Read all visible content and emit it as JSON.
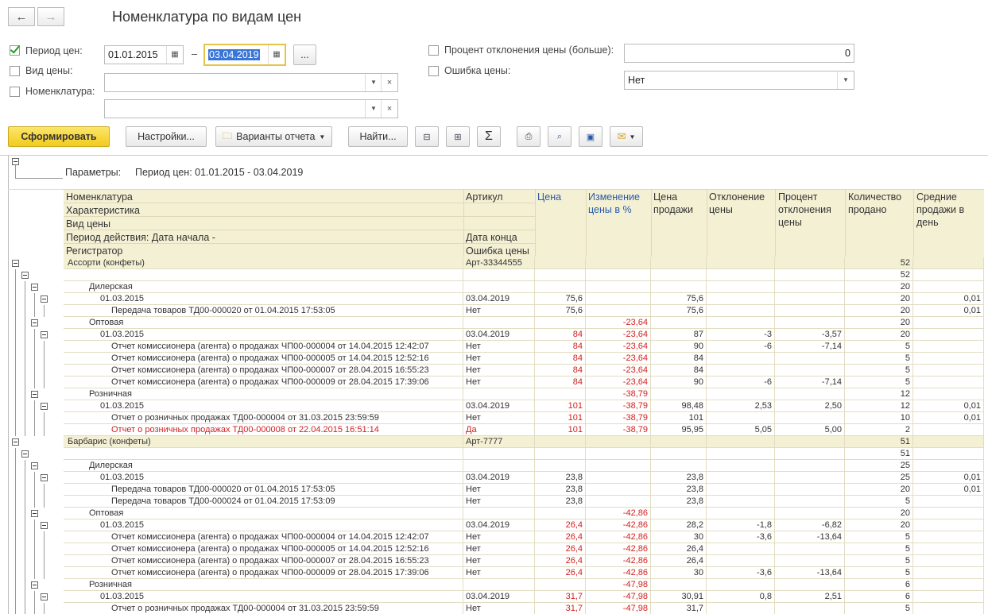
{
  "window": {
    "title": "Номенклатура по видам цен",
    "back_icon": "arrow-left-icon",
    "forward_icon": "arrow-right-icon"
  },
  "filters": {
    "period_label": "Период цен:",
    "period_checked": true,
    "date_from": "01.01.2015",
    "date_dash": "–",
    "date_to": "03.04.2019",
    "period_more": "...",
    "price_type_label": "Вид цены:",
    "nomenclature_label": "Номенклатура:",
    "deviation_label": "Процент отклонения цены (больше):",
    "deviation_value": "0",
    "price_error_label": "Ошибка цены:",
    "price_error_value": "Нет"
  },
  "toolbar": {
    "generate": "Сформировать",
    "settings": "Настройки...",
    "variants": "Варианты отчета",
    "find": "Найти..."
  },
  "report": {
    "params_label": "Параметры:",
    "params_value": "Период цен: 01.01.2015 - 03.04.2019",
    "header": {
      "nom": "Номенклатура",
      "char": "Характеристика",
      "price_type": "Вид цены",
      "period": "Период действия: Дата начала -",
      "registrar": "Регистратор",
      "article": "Артикул",
      "date_end": "Дата конца",
      "price_error": "Ошибка цены",
      "price": "Цена",
      "change": "Изменение цены в %",
      "sale_price": "Цена продажи",
      "deviation": "Отклонение цены",
      "dev_percent": "Процент отклонения цены",
      "qty": "Количество продано",
      "avg": "Средние продажи в день"
    },
    "rows": [
      {
        "lvl": 0,
        "text": "Ассорти (конфеты)",
        "art": "Арт-33344555",
        "price": "",
        "change": "",
        "sale": "",
        "dev": "",
        "pct": "",
        "qty": "52",
        "avg": "",
        "red": false,
        "group": true
      },
      {
        "lvl": 1,
        "text": "",
        "art": "",
        "price": "",
        "change": "",
        "sale": "",
        "dev": "",
        "pct": "",
        "qty": "52",
        "avg": "",
        "red": false,
        "group": false
      },
      {
        "lvl": 2,
        "text": "Дилерская",
        "art": "",
        "price": "",
        "change": "",
        "sale": "",
        "dev": "",
        "pct": "",
        "qty": "20",
        "avg": "",
        "red": false,
        "group": false
      },
      {
        "lvl": 3,
        "text": "01.03.2015",
        "art": "03.04.2019",
        "price": "75,6",
        "change": "",
        "sale": "75,6",
        "dev": "",
        "pct": "",
        "qty": "20",
        "avg": "0,01",
        "red": false,
        "group": false
      },
      {
        "lvl": 4,
        "text": "Передача товаров ТД00-000020 от 01.04.2015 17:53:05",
        "art": "Нет",
        "price": "75,6",
        "change": "",
        "sale": "75,6",
        "dev": "",
        "pct": "",
        "qty": "20",
        "avg": "0,01",
        "red": false,
        "group": false
      },
      {
        "lvl": 2,
        "text": "Оптовая",
        "art": "",
        "price": "",
        "change": "-23,64",
        "sale": "",
        "dev": "",
        "pct": "",
        "qty": "20",
        "avg": "",
        "red": false,
        "group": false
      },
      {
        "lvl": 3,
        "text": "01.03.2015",
        "art": "03.04.2019",
        "price": "84",
        "change": "-23,64",
        "sale": "87",
        "dev": "-3",
        "pct": "-3,57",
        "qty": "20",
        "avg": "",
        "red": false,
        "group": false
      },
      {
        "lvl": 4,
        "text": "Отчет комиссионера (агента) о продажах ЧП00-000004 от 14.04.2015 12:42:07",
        "art": "Нет",
        "price": "84",
        "change": "-23,64",
        "sale": "90",
        "dev": "-6",
        "pct": "-7,14",
        "qty": "5",
        "avg": "",
        "red": false,
        "group": false
      },
      {
        "lvl": 4,
        "text": "Отчет комиссионера (агента) о продажах ЧП00-000005 от 14.04.2015 12:52:16",
        "art": "Нет",
        "price": "84",
        "change": "-23,64",
        "sale": "84",
        "dev": "",
        "pct": "",
        "qty": "5",
        "avg": "",
        "red": false,
        "group": false
      },
      {
        "lvl": 4,
        "text": "Отчет комиссионера (агента) о продажах ЧП00-000007 от 28.04.2015 16:55:23",
        "art": "Нет",
        "price": "84",
        "change": "-23,64",
        "sale": "84",
        "dev": "",
        "pct": "",
        "qty": "5",
        "avg": "",
        "red": false,
        "group": false
      },
      {
        "lvl": 4,
        "text": "Отчет комиссионера (агента) о продажах ЧП00-000009 от 28.04.2015 17:39:06",
        "art": "Нет",
        "price": "84",
        "change": "-23,64",
        "sale": "90",
        "dev": "-6",
        "pct": "-7,14",
        "qty": "5",
        "avg": "",
        "red": false,
        "group": false
      },
      {
        "lvl": 2,
        "text": "Розничная",
        "art": "",
        "price": "",
        "change": "-38,79",
        "sale": "",
        "dev": "",
        "pct": "",
        "qty": "12",
        "avg": "",
        "red": false,
        "group": false
      },
      {
        "lvl": 3,
        "text": "01.03.2015",
        "art": "03.04.2019",
        "price": "101",
        "change": "-38,79",
        "sale": "98,48",
        "dev": "2,53",
        "pct": "2,50",
        "qty": "12",
        "avg": "0,01",
        "red": false,
        "group": false
      },
      {
        "lvl": 4,
        "text": "Отчет о розничных продажах ТД00-000004 от 31.03.2015 23:59:59",
        "art": "Нет",
        "price": "101",
        "change": "-38,79",
        "sale": "101",
        "dev": "",
        "pct": "",
        "qty": "10",
        "avg": "0,01",
        "red": false,
        "group": false
      },
      {
        "lvl": 4,
        "text": "Отчет о розничных продажах ТД00-000008 от 22.04.2015 16:51:14",
        "art": "Да",
        "price": "101",
        "change": "-38,79",
        "sale": "95,95",
        "dev": "5,05",
        "pct": "5,00",
        "qty": "2",
        "avg": "",
        "red": true,
        "group": false
      },
      {
        "lvl": 0,
        "text": "Барбарис (конфеты)",
        "art": "Арт-7777",
        "price": "",
        "change": "",
        "sale": "",
        "dev": "",
        "pct": "",
        "qty": "51",
        "avg": "",
        "red": false,
        "group": true
      },
      {
        "lvl": 1,
        "text": "",
        "art": "",
        "price": "",
        "change": "",
        "sale": "",
        "dev": "",
        "pct": "",
        "qty": "51",
        "avg": "",
        "red": false,
        "group": false
      },
      {
        "lvl": 2,
        "text": "Дилерская",
        "art": "",
        "price": "",
        "change": "",
        "sale": "",
        "dev": "",
        "pct": "",
        "qty": "25",
        "avg": "",
        "red": false,
        "group": false
      },
      {
        "lvl": 3,
        "text": "01.03.2015",
        "art": "03.04.2019",
        "price": "23,8",
        "change": "",
        "sale": "23,8",
        "dev": "",
        "pct": "",
        "qty": "25",
        "avg": "0,01",
        "red": false,
        "group": false
      },
      {
        "lvl": 4,
        "text": "Передача товаров ТД00-000020 от 01.04.2015 17:53:05",
        "art": "Нет",
        "price": "23,8",
        "change": "",
        "sale": "23,8",
        "dev": "",
        "pct": "",
        "qty": "20",
        "avg": "0,01",
        "red": false,
        "group": false
      },
      {
        "lvl": 4,
        "text": "Передача товаров ТД00-000024 от 01.04.2015 17:53:09",
        "art": "Нет",
        "price": "23,8",
        "change": "",
        "sale": "23,8",
        "dev": "",
        "pct": "",
        "qty": "5",
        "avg": "",
        "red": false,
        "group": false
      },
      {
        "lvl": 2,
        "text": "Оптовая",
        "art": "",
        "price": "",
        "change": "-42,86",
        "sale": "",
        "dev": "",
        "pct": "",
        "qty": "20",
        "avg": "",
        "red": false,
        "group": false
      },
      {
        "lvl": 3,
        "text": "01.03.2015",
        "art": "03.04.2019",
        "price": "26,4",
        "change": "-42,86",
        "sale": "28,2",
        "dev": "-1,8",
        "pct": "-6,82",
        "qty": "20",
        "avg": "",
        "red": false,
        "group": false
      },
      {
        "lvl": 4,
        "text": "Отчет комиссионера (агента) о продажах ЧП00-000004 от 14.04.2015 12:42:07",
        "art": "Нет",
        "price": "26,4",
        "change": "-42,86",
        "sale": "30",
        "dev": "-3,6",
        "pct": "-13,64",
        "qty": "5",
        "avg": "",
        "red": false,
        "group": false
      },
      {
        "lvl": 4,
        "text": "Отчет комиссионера (агента) о продажах ЧП00-000005 от 14.04.2015 12:52:16",
        "art": "Нет",
        "price": "26,4",
        "change": "-42,86",
        "sale": "26,4",
        "dev": "",
        "pct": "",
        "qty": "5",
        "avg": "",
        "red": false,
        "group": false
      },
      {
        "lvl": 4,
        "text": "Отчет комиссионера (агента) о продажах ЧП00-000007 от 28.04.2015 16:55:23",
        "art": "Нет",
        "price": "26,4",
        "change": "-42,86",
        "sale": "26,4",
        "dev": "",
        "pct": "",
        "qty": "5",
        "avg": "",
        "red": false,
        "group": false
      },
      {
        "lvl": 4,
        "text": "Отчет комиссионера (агента) о продажах ЧП00-000009 от 28.04.2015 17:39:06",
        "art": "Нет",
        "price": "26,4",
        "change": "-42,86",
        "sale": "30",
        "dev": "-3,6",
        "pct": "-13,64",
        "qty": "5",
        "avg": "",
        "red": false,
        "group": false
      },
      {
        "lvl": 2,
        "text": "Розничная",
        "art": "",
        "price": "",
        "change": "-47,98",
        "sale": "",
        "dev": "",
        "pct": "",
        "qty": "6",
        "avg": "",
        "red": false,
        "group": false
      },
      {
        "lvl": 3,
        "text": "01.03.2015",
        "art": "03.04.2019",
        "price": "31,7",
        "change": "-47,98",
        "sale": "30,91",
        "dev": "0,8",
        "pct": "2,51",
        "qty": "6",
        "avg": "",
        "red": false,
        "group": false
      },
      {
        "lvl": 4,
        "text": "Отчет о розничных продажах ТД00-000004 от 31.03.2015 23:59:59",
        "art": "Нет",
        "price": "31,7",
        "change": "-47,98",
        "sale": "31,7",
        "dev": "",
        "pct": "",
        "qty": "5",
        "avg": "",
        "red": false,
        "group": false
      }
    ]
  }
}
